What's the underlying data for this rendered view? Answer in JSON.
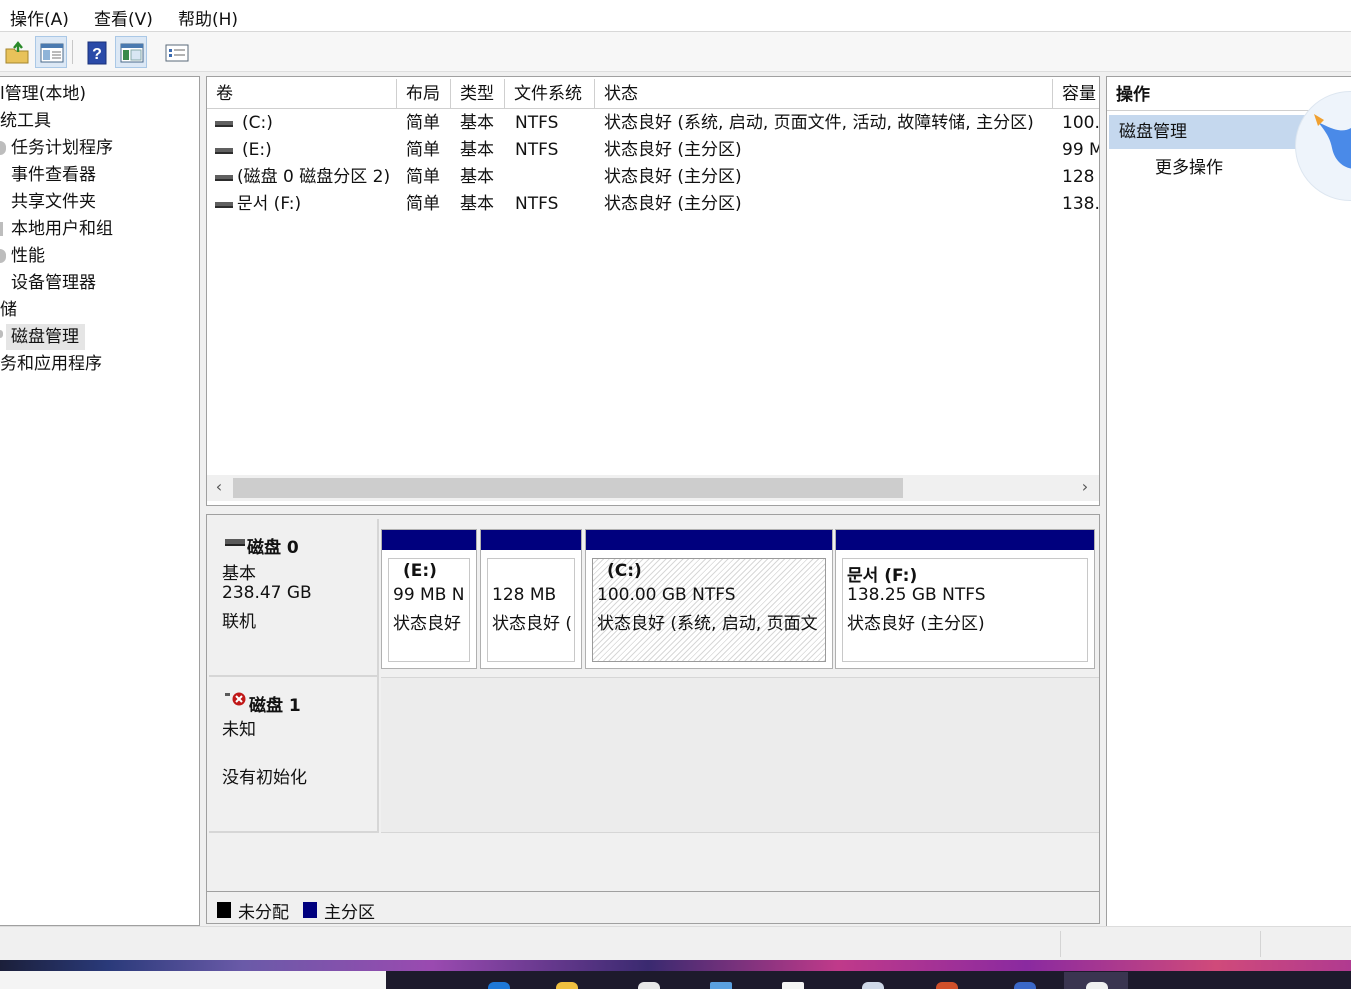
{
  "menu": [
    "操作(A)",
    "查看(V)",
    "帮助(H)"
  ],
  "toolbar": {
    "icons": [
      "up-folder-icon",
      "show-hide-console-tree-icon",
      "help-icon",
      "show-hide-action-pane-icon",
      "properties-icon"
    ]
  },
  "tree": {
    "items": [
      "l管理(本地)",
      "统工具",
      "任务计划程序",
      "事件查看器",
      "共享文件夹",
      "本地用户和组",
      "性能",
      "设备管理器",
      "储",
      "磁盘管理",
      "务和应用程序"
    ],
    "selected": "磁盘管理"
  },
  "volumes": {
    "columns": [
      "卷",
      "布局",
      "类型",
      "文件系统",
      "状态",
      "容量"
    ],
    "rows": [
      {
        "name": "(C:)",
        "layout": "简单",
        "type": "基本",
        "fs": "NTFS",
        "status": "状态良好 (系统, 启动, 页面文件, 活动, 故障转储, 主分区)",
        "capacity": "100."
      },
      {
        "name": "(E:)",
        "layout": "简单",
        "type": "基本",
        "fs": "NTFS",
        "status": "状态良好 (主分区)",
        "capacity": "99 M"
      },
      {
        "name": "(磁盘 0 磁盘分区 2)",
        "layout": "简单",
        "type": "基本",
        "fs": "",
        "status": "状态良好 (主分区)",
        "capacity": "128"
      },
      {
        "name": "문서 (F:)",
        "layout": "简单",
        "type": "基本",
        "fs": "NTFS",
        "status": "状态良好 (主分区)",
        "capacity": "138."
      }
    ],
    "scroll_left": "‹",
    "scroll_right": "›"
  },
  "disk0": {
    "name": "磁盘 0",
    "type": "基本",
    "size": "238.47 GB",
    "state": "联机",
    "partitions": [
      {
        "name": "(E:)",
        "size": "99 MB N",
        "status": "状态良好"
      },
      {
        "name": "",
        "size": "128 MB",
        "status": "状态良好 ("
      },
      {
        "name": "(C:)",
        "size": "100.00 GB NTFS",
        "status": "状态良好 (系统, 启动, 页面文"
      },
      {
        "name": "문서  (F:)",
        "size": "138.25 GB NTFS",
        "status": "状态良好 (主分区)"
      }
    ]
  },
  "disk1": {
    "name": "磁盘 1",
    "type": "未知",
    "state": "没有初始化"
  },
  "legend": [
    {
      "label": "未分配",
      "color": "#000000"
    },
    {
      "label": "主分区",
      "color": "#00007e"
    }
  ],
  "actions": {
    "header": "操作",
    "section": "磁盘管理",
    "more": "更多操作"
  },
  "colors": {
    "primary_partition": "#00007e",
    "selection": "#c5d8ee"
  }
}
